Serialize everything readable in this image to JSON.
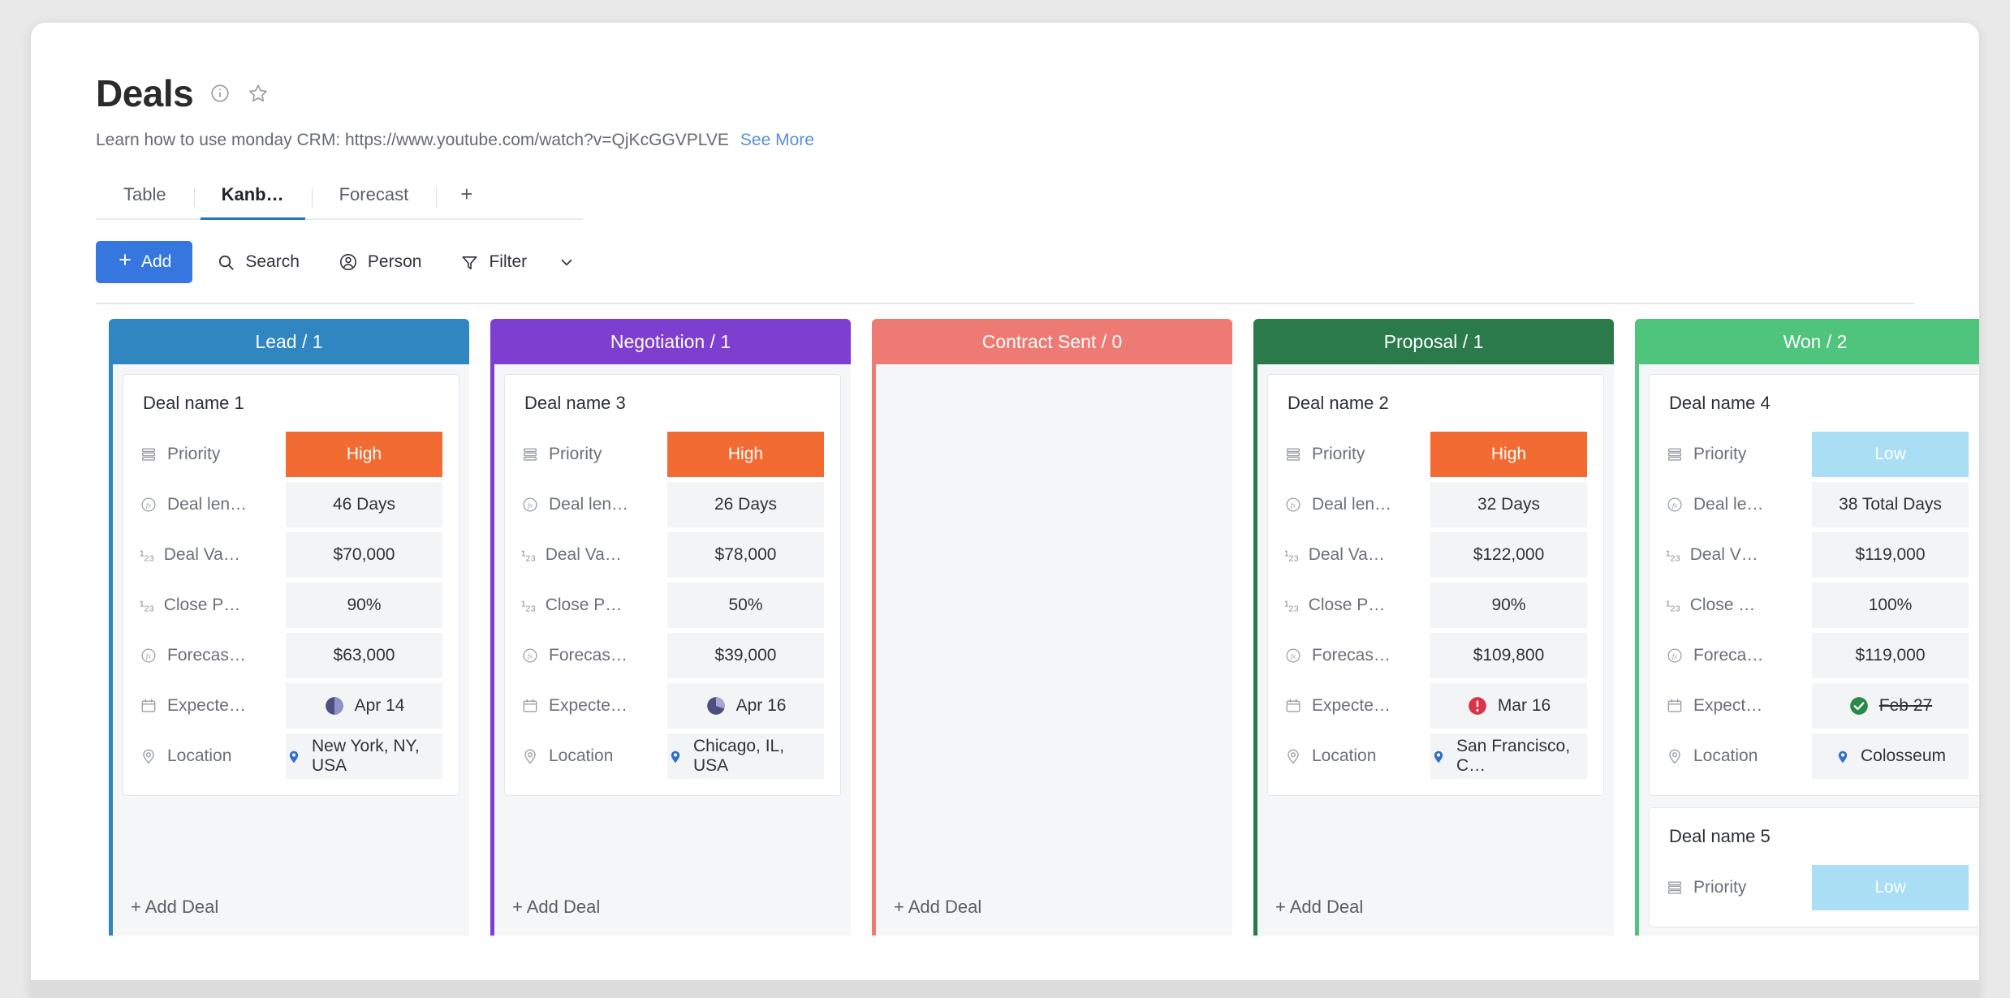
{
  "header": {
    "title": "Deals",
    "info_icon": "info-circle-icon",
    "star_icon": "star-outline-icon",
    "subtitle": "Learn how to use monday CRM: https://www.youtube.com/watch?v=QjKcGGVPLVE",
    "see_more": "See More"
  },
  "tabs": [
    {
      "label": "Table",
      "active": false
    },
    {
      "label": "Kanb…",
      "active": true
    },
    {
      "label": "Forecast",
      "active": false
    },
    {
      "label": "+",
      "active": false
    }
  ],
  "toolbar": {
    "add_label": "Add",
    "search_label": "Search",
    "person_label": "Person",
    "filter_label": "Filter",
    "accent_color": "#3577df"
  },
  "board": {
    "add_deal_label": "+ Add Deal",
    "columns": [
      {
        "id": "lead",
        "title": "Lead / 1",
        "color": "#2f86c0",
        "count": 1,
        "cards": [
          {
            "name": "Deal name 1",
            "fields": [
              {
                "icon": "status-list-icon",
                "label": "Priority",
                "value": "High",
                "style": "status-high"
              },
              {
                "icon": "formula-icon",
                "label": "Deal len…",
                "value": "46 Days",
                "style": "plain"
              },
              {
                "icon": "numbers-icon",
                "label": "Deal Va…",
                "value": "$70,000",
                "style": "plain"
              },
              {
                "icon": "numbers-icon",
                "label": "Close P…",
                "value": "90%",
                "style": "plain"
              },
              {
                "icon": "formula-icon",
                "label": "Forecas…",
                "value": "$63,000",
                "style": "plain"
              },
              {
                "icon": "calendar-icon",
                "label": "Expecte…",
                "value": "Apr 14",
                "style": "date",
                "marker": "half-dark"
              },
              {
                "icon": "location-icon",
                "label": "Location",
                "value": "New York, NY, USA",
                "style": "location"
              }
            ]
          }
        ]
      },
      {
        "id": "negotiation",
        "title": "Negotiation / 1",
        "color": "#7e3ecf",
        "count": 1,
        "cards": [
          {
            "name": "Deal name 3",
            "fields": [
              {
                "icon": "status-list-icon",
                "label": "Priority",
                "value": "High",
                "style": "status-high"
              },
              {
                "icon": "formula-icon",
                "label": "Deal len…",
                "value": "26 Days",
                "style": "plain"
              },
              {
                "icon": "numbers-icon",
                "label": "Deal Va…",
                "value": "$78,000",
                "style": "plain"
              },
              {
                "icon": "numbers-icon",
                "label": "Close P…",
                "value": "50%",
                "style": "plain"
              },
              {
                "icon": "formula-icon",
                "label": "Forecas…",
                "value": "$39,000",
                "style": "plain"
              },
              {
                "icon": "calendar-icon",
                "label": "Expecte…",
                "value": "Apr 16",
                "style": "date",
                "marker": "pie-dark"
              },
              {
                "icon": "location-icon",
                "label": "Location",
                "value": "Chicago, IL, USA",
                "style": "location"
              }
            ]
          }
        ]
      },
      {
        "id": "contract-sent",
        "title": "Contract Sent / 0",
        "color": "#ee7a74",
        "count": 0,
        "cards": []
      },
      {
        "id": "proposal",
        "title": "Proposal / 1",
        "color": "#2b7a4b",
        "count": 1,
        "cards": [
          {
            "name": "Deal name 2",
            "fields": [
              {
                "icon": "status-list-icon",
                "label": "Priority",
                "value": "High",
                "style": "status-high"
              },
              {
                "icon": "formula-icon",
                "label": "Deal len…",
                "value": "32 Days",
                "style": "plain"
              },
              {
                "icon": "numbers-icon",
                "label": "Deal Va…",
                "value": "$122,000",
                "style": "plain"
              },
              {
                "icon": "numbers-icon",
                "label": "Close P…",
                "value": "90%",
                "style": "plain"
              },
              {
                "icon": "formula-icon",
                "label": "Forecas…",
                "value": "$109,800",
                "style": "plain"
              },
              {
                "icon": "calendar-icon",
                "label": "Expecte…",
                "value": "Mar 16",
                "style": "date",
                "marker": "alert-red"
              },
              {
                "icon": "location-icon",
                "label": "Location",
                "value": "San Francisco, C…",
                "style": "location"
              }
            ]
          }
        ]
      },
      {
        "id": "won",
        "title": "Won / 2",
        "color": "#4fc47c",
        "count": 2,
        "scrollbar": true,
        "cards": [
          {
            "name": "Deal name 4",
            "fields": [
              {
                "icon": "status-list-icon",
                "label": "Priority",
                "value": "Low",
                "style": "status-low"
              },
              {
                "icon": "formula-icon",
                "label": "Deal le…",
                "value": "38 Total Days",
                "style": "plain"
              },
              {
                "icon": "numbers-icon",
                "label": "Deal V…",
                "value": "$119,000",
                "style": "plain"
              },
              {
                "icon": "numbers-icon",
                "label": "Close …",
                "value": "100%",
                "style": "plain"
              },
              {
                "icon": "formula-icon",
                "label": "Foreca…",
                "value": "$119,000",
                "style": "plain"
              },
              {
                "icon": "calendar-icon",
                "label": "Expect…",
                "value": "Feb 27",
                "style": "date-done",
                "marker": "check-green"
              },
              {
                "icon": "location-icon",
                "label": "Location",
                "value": "Colosseum",
                "style": "location"
              }
            ]
          },
          {
            "name": "Deal name 5",
            "fields": [
              {
                "icon": "status-list-icon",
                "label": "Priority",
                "value": "Low",
                "style": "status-low"
              }
            ]
          }
        ]
      }
    ]
  }
}
